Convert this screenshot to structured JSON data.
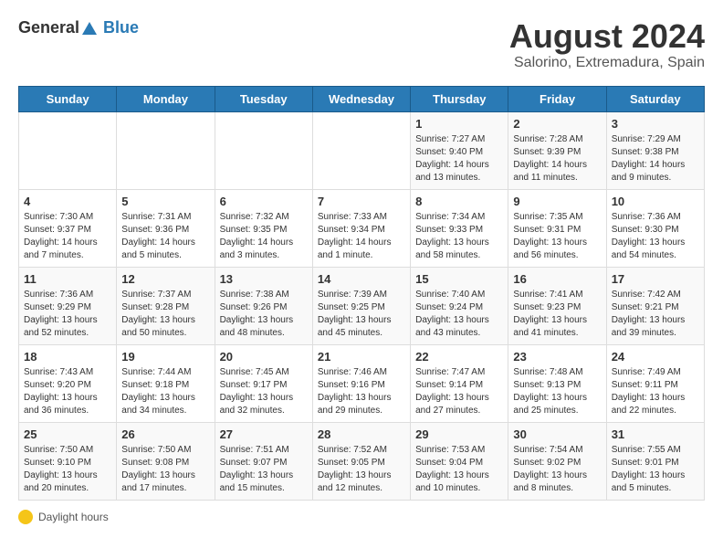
{
  "header": {
    "logo_general": "General",
    "logo_blue": "Blue",
    "title": "August 2024",
    "subtitle": "Salorino, Extremadura, Spain"
  },
  "days_of_week": [
    "Sunday",
    "Monday",
    "Tuesday",
    "Wednesday",
    "Thursday",
    "Friday",
    "Saturday"
  ],
  "weeks": [
    [
      {
        "day": "",
        "info": ""
      },
      {
        "day": "",
        "info": ""
      },
      {
        "day": "",
        "info": ""
      },
      {
        "day": "",
        "info": ""
      },
      {
        "day": "1",
        "info": "Sunrise: 7:27 AM\nSunset: 9:40 PM\nDaylight: 14 hours\nand 13 minutes."
      },
      {
        "day": "2",
        "info": "Sunrise: 7:28 AM\nSunset: 9:39 PM\nDaylight: 14 hours\nand 11 minutes."
      },
      {
        "day": "3",
        "info": "Sunrise: 7:29 AM\nSunset: 9:38 PM\nDaylight: 14 hours\nand 9 minutes."
      }
    ],
    [
      {
        "day": "4",
        "info": "Sunrise: 7:30 AM\nSunset: 9:37 PM\nDaylight: 14 hours\nand 7 minutes."
      },
      {
        "day": "5",
        "info": "Sunrise: 7:31 AM\nSunset: 9:36 PM\nDaylight: 14 hours\nand 5 minutes."
      },
      {
        "day": "6",
        "info": "Sunrise: 7:32 AM\nSunset: 9:35 PM\nDaylight: 14 hours\nand 3 minutes."
      },
      {
        "day": "7",
        "info": "Sunrise: 7:33 AM\nSunset: 9:34 PM\nDaylight: 14 hours\nand 1 minute."
      },
      {
        "day": "8",
        "info": "Sunrise: 7:34 AM\nSunset: 9:33 PM\nDaylight: 13 hours\nand 58 minutes."
      },
      {
        "day": "9",
        "info": "Sunrise: 7:35 AM\nSunset: 9:31 PM\nDaylight: 13 hours\nand 56 minutes."
      },
      {
        "day": "10",
        "info": "Sunrise: 7:36 AM\nSunset: 9:30 PM\nDaylight: 13 hours\nand 54 minutes."
      }
    ],
    [
      {
        "day": "11",
        "info": "Sunrise: 7:36 AM\nSunset: 9:29 PM\nDaylight: 13 hours\nand 52 minutes."
      },
      {
        "day": "12",
        "info": "Sunrise: 7:37 AM\nSunset: 9:28 PM\nDaylight: 13 hours\nand 50 minutes."
      },
      {
        "day": "13",
        "info": "Sunrise: 7:38 AM\nSunset: 9:26 PM\nDaylight: 13 hours\nand 48 minutes."
      },
      {
        "day": "14",
        "info": "Sunrise: 7:39 AM\nSunset: 9:25 PM\nDaylight: 13 hours\nand 45 minutes."
      },
      {
        "day": "15",
        "info": "Sunrise: 7:40 AM\nSunset: 9:24 PM\nDaylight: 13 hours\nand 43 minutes."
      },
      {
        "day": "16",
        "info": "Sunrise: 7:41 AM\nSunset: 9:23 PM\nDaylight: 13 hours\nand 41 minutes."
      },
      {
        "day": "17",
        "info": "Sunrise: 7:42 AM\nSunset: 9:21 PM\nDaylight: 13 hours\nand 39 minutes."
      }
    ],
    [
      {
        "day": "18",
        "info": "Sunrise: 7:43 AM\nSunset: 9:20 PM\nDaylight: 13 hours\nand 36 minutes."
      },
      {
        "day": "19",
        "info": "Sunrise: 7:44 AM\nSunset: 9:18 PM\nDaylight: 13 hours\nand 34 minutes."
      },
      {
        "day": "20",
        "info": "Sunrise: 7:45 AM\nSunset: 9:17 PM\nDaylight: 13 hours\nand 32 minutes."
      },
      {
        "day": "21",
        "info": "Sunrise: 7:46 AM\nSunset: 9:16 PM\nDaylight: 13 hours\nand 29 minutes."
      },
      {
        "day": "22",
        "info": "Sunrise: 7:47 AM\nSunset: 9:14 PM\nDaylight: 13 hours\nand 27 minutes."
      },
      {
        "day": "23",
        "info": "Sunrise: 7:48 AM\nSunset: 9:13 PM\nDaylight: 13 hours\nand 25 minutes."
      },
      {
        "day": "24",
        "info": "Sunrise: 7:49 AM\nSunset: 9:11 PM\nDaylight: 13 hours\nand 22 minutes."
      }
    ],
    [
      {
        "day": "25",
        "info": "Sunrise: 7:50 AM\nSunset: 9:10 PM\nDaylight: 13 hours\nand 20 minutes."
      },
      {
        "day": "26",
        "info": "Sunrise: 7:50 AM\nSunset: 9:08 PM\nDaylight: 13 hours\nand 17 minutes."
      },
      {
        "day": "27",
        "info": "Sunrise: 7:51 AM\nSunset: 9:07 PM\nDaylight: 13 hours\nand 15 minutes."
      },
      {
        "day": "28",
        "info": "Sunrise: 7:52 AM\nSunset: 9:05 PM\nDaylight: 13 hours\nand 12 minutes."
      },
      {
        "day": "29",
        "info": "Sunrise: 7:53 AM\nSunset: 9:04 PM\nDaylight: 13 hours\nand 10 minutes."
      },
      {
        "day": "30",
        "info": "Sunrise: 7:54 AM\nSunset: 9:02 PM\nDaylight: 13 hours\nand 8 minutes."
      },
      {
        "day": "31",
        "info": "Sunrise: 7:55 AM\nSunset: 9:01 PM\nDaylight: 13 hours\nand 5 minutes."
      }
    ]
  ],
  "footer": {
    "daylight_label": "Daylight hours"
  }
}
